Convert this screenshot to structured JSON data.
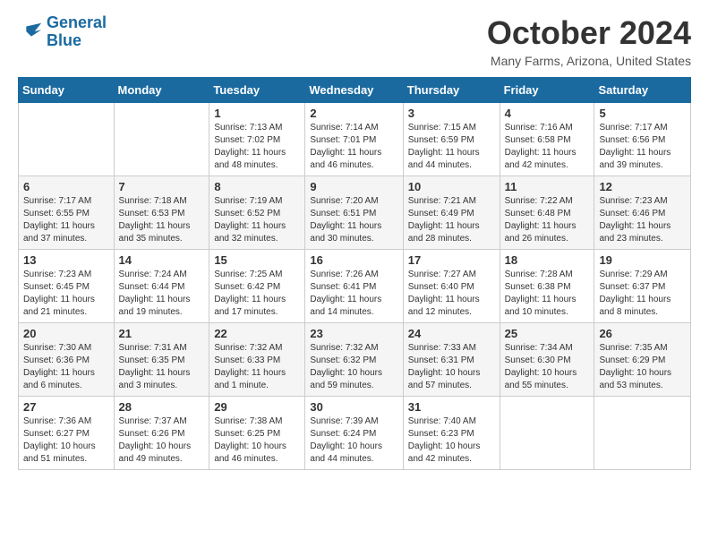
{
  "header": {
    "logo_line1": "General",
    "logo_line2": "Blue",
    "title": "October 2024",
    "location": "Many Farms, Arizona, United States"
  },
  "days_of_week": [
    "Sunday",
    "Monday",
    "Tuesday",
    "Wednesday",
    "Thursday",
    "Friday",
    "Saturday"
  ],
  "weeks": [
    [
      {
        "day": "",
        "info": ""
      },
      {
        "day": "",
        "info": ""
      },
      {
        "day": "1",
        "info": "Sunrise: 7:13 AM\nSunset: 7:02 PM\nDaylight: 11 hours and 48 minutes."
      },
      {
        "day": "2",
        "info": "Sunrise: 7:14 AM\nSunset: 7:01 PM\nDaylight: 11 hours and 46 minutes."
      },
      {
        "day": "3",
        "info": "Sunrise: 7:15 AM\nSunset: 6:59 PM\nDaylight: 11 hours and 44 minutes."
      },
      {
        "day": "4",
        "info": "Sunrise: 7:16 AM\nSunset: 6:58 PM\nDaylight: 11 hours and 42 minutes."
      },
      {
        "day": "5",
        "info": "Sunrise: 7:17 AM\nSunset: 6:56 PM\nDaylight: 11 hours and 39 minutes."
      }
    ],
    [
      {
        "day": "6",
        "info": "Sunrise: 7:17 AM\nSunset: 6:55 PM\nDaylight: 11 hours and 37 minutes."
      },
      {
        "day": "7",
        "info": "Sunrise: 7:18 AM\nSunset: 6:53 PM\nDaylight: 11 hours and 35 minutes."
      },
      {
        "day": "8",
        "info": "Sunrise: 7:19 AM\nSunset: 6:52 PM\nDaylight: 11 hours and 32 minutes."
      },
      {
        "day": "9",
        "info": "Sunrise: 7:20 AM\nSunset: 6:51 PM\nDaylight: 11 hours and 30 minutes."
      },
      {
        "day": "10",
        "info": "Sunrise: 7:21 AM\nSunset: 6:49 PM\nDaylight: 11 hours and 28 minutes."
      },
      {
        "day": "11",
        "info": "Sunrise: 7:22 AM\nSunset: 6:48 PM\nDaylight: 11 hours and 26 minutes."
      },
      {
        "day": "12",
        "info": "Sunrise: 7:23 AM\nSunset: 6:46 PM\nDaylight: 11 hours and 23 minutes."
      }
    ],
    [
      {
        "day": "13",
        "info": "Sunrise: 7:23 AM\nSunset: 6:45 PM\nDaylight: 11 hours and 21 minutes."
      },
      {
        "day": "14",
        "info": "Sunrise: 7:24 AM\nSunset: 6:44 PM\nDaylight: 11 hours and 19 minutes."
      },
      {
        "day": "15",
        "info": "Sunrise: 7:25 AM\nSunset: 6:42 PM\nDaylight: 11 hours and 17 minutes."
      },
      {
        "day": "16",
        "info": "Sunrise: 7:26 AM\nSunset: 6:41 PM\nDaylight: 11 hours and 14 minutes."
      },
      {
        "day": "17",
        "info": "Sunrise: 7:27 AM\nSunset: 6:40 PM\nDaylight: 11 hours and 12 minutes."
      },
      {
        "day": "18",
        "info": "Sunrise: 7:28 AM\nSunset: 6:38 PM\nDaylight: 11 hours and 10 minutes."
      },
      {
        "day": "19",
        "info": "Sunrise: 7:29 AM\nSunset: 6:37 PM\nDaylight: 11 hours and 8 minutes."
      }
    ],
    [
      {
        "day": "20",
        "info": "Sunrise: 7:30 AM\nSunset: 6:36 PM\nDaylight: 11 hours and 6 minutes."
      },
      {
        "day": "21",
        "info": "Sunrise: 7:31 AM\nSunset: 6:35 PM\nDaylight: 11 hours and 3 minutes."
      },
      {
        "day": "22",
        "info": "Sunrise: 7:32 AM\nSunset: 6:33 PM\nDaylight: 11 hours and 1 minute."
      },
      {
        "day": "23",
        "info": "Sunrise: 7:32 AM\nSunset: 6:32 PM\nDaylight: 10 hours and 59 minutes."
      },
      {
        "day": "24",
        "info": "Sunrise: 7:33 AM\nSunset: 6:31 PM\nDaylight: 10 hours and 57 minutes."
      },
      {
        "day": "25",
        "info": "Sunrise: 7:34 AM\nSunset: 6:30 PM\nDaylight: 10 hours and 55 minutes."
      },
      {
        "day": "26",
        "info": "Sunrise: 7:35 AM\nSunset: 6:29 PM\nDaylight: 10 hours and 53 minutes."
      }
    ],
    [
      {
        "day": "27",
        "info": "Sunrise: 7:36 AM\nSunset: 6:27 PM\nDaylight: 10 hours and 51 minutes."
      },
      {
        "day": "28",
        "info": "Sunrise: 7:37 AM\nSunset: 6:26 PM\nDaylight: 10 hours and 49 minutes."
      },
      {
        "day": "29",
        "info": "Sunrise: 7:38 AM\nSunset: 6:25 PM\nDaylight: 10 hours and 46 minutes."
      },
      {
        "day": "30",
        "info": "Sunrise: 7:39 AM\nSunset: 6:24 PM\nDaylight: 10 hours and 44 minutes."
      },
      {
        "day": "31",
        "info": "Sunrise: 7:40 AM\nSunset: 6:23 PM\nDaylight: 10 hours and 42 minutes."
      },
      {
        "day": "",
        "info": ""
      },
      {
        "day": "",
        "info": ""
      }
    ]
  ]
}
